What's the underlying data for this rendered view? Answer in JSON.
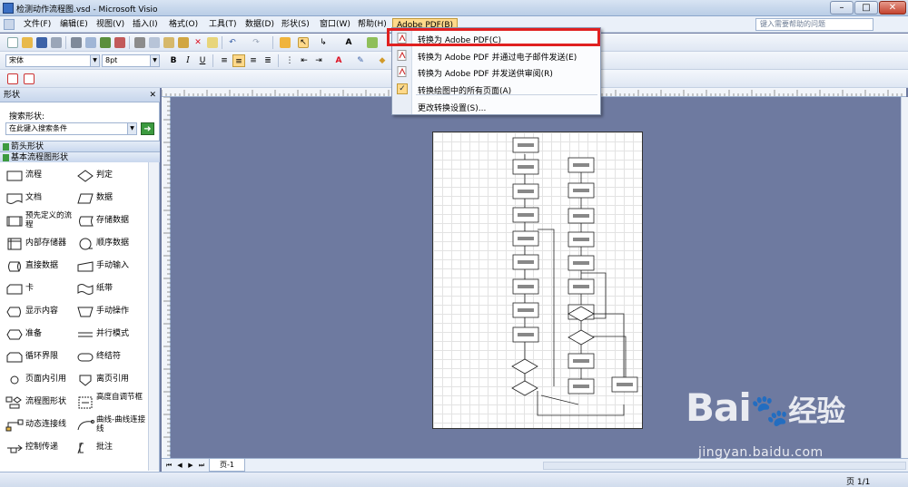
{
  "window": {
    "title": "检测动作流程图.vsd - Microsoft Visio"
  },
  "menubar": {
    "items": [
      "文件(F)",
      "编辑(E)",
      "视图(V)",
      "插入(I)",
      "格式(O)",
      "工具(T)",
      "数据(D)",
      "形状(S)",
      "窗口(W)",
      "帮助(H)",
      "Adobe PDF(B)"
    ],
    "help_placeholder": "键入需要帮助的问题"
  },
  "format_toolbar": {
    "font": "宋体",
    "size": "8pt"
  },
  "pdf_menu": {
    "items": [
      "转换为 Adobe PDF(C)",
      "转换为 Adobe PDF 并通过电子邮件发送(E)",
      "转换为 Adobe PDF 并发送供审阅(R)",
      "转换绘图中的所有页面(A)",
      "更改转换设置(S)..."
    ]
  },
  "shapes_panel": {
    "header": "形状",
    "search_label": "搜索形状:",
    "search_placeholder": "在此键入搜索条件",
    "stencils": [
      "箭头形状",
      "基本流程图形状"
    ],
    "shapes": [
      [
        "流程",
        "判定"
      ],
      [
        "文档",
        "数据"
      ],
      [
        "预先定义的流程",
        "存储数据"
      ],
      [
        "内部存储器",
        "顺序数据"
      ],
      [
        "直接数据",
        "手动输入"
      ],
      [
        "卡",
        "纸带"
      ],
      [
        "显示内容",
        "手动操作"
      ],
      [
        "准备",
        "并行模式"
      ],
      [
        "循环界限",
        "终结符"
      ],
      [
        "页面内引用",
        "离页引用"
      ],
      [
        "流程图形状",
        "高度自调节框"
      ],
      [
        "动态连接线",
        "曲线-曲线连接线"
      ],
      [
        "控制传递",
        "批注"
      ]
    ]
  },
  "page_tab": "页-1",
  "status": {
    "page": "页 1/1"
  },
  "watermark": {
    "brand": "Bai",
    "brand2": "经验",
    "url": "jingyan.baidu.com"
  },
  "colors": {
    "highlight": "#e02020",
    "menu_active": "#ffd98a",
    "canvas": "#6e7aa0"
  }
}
